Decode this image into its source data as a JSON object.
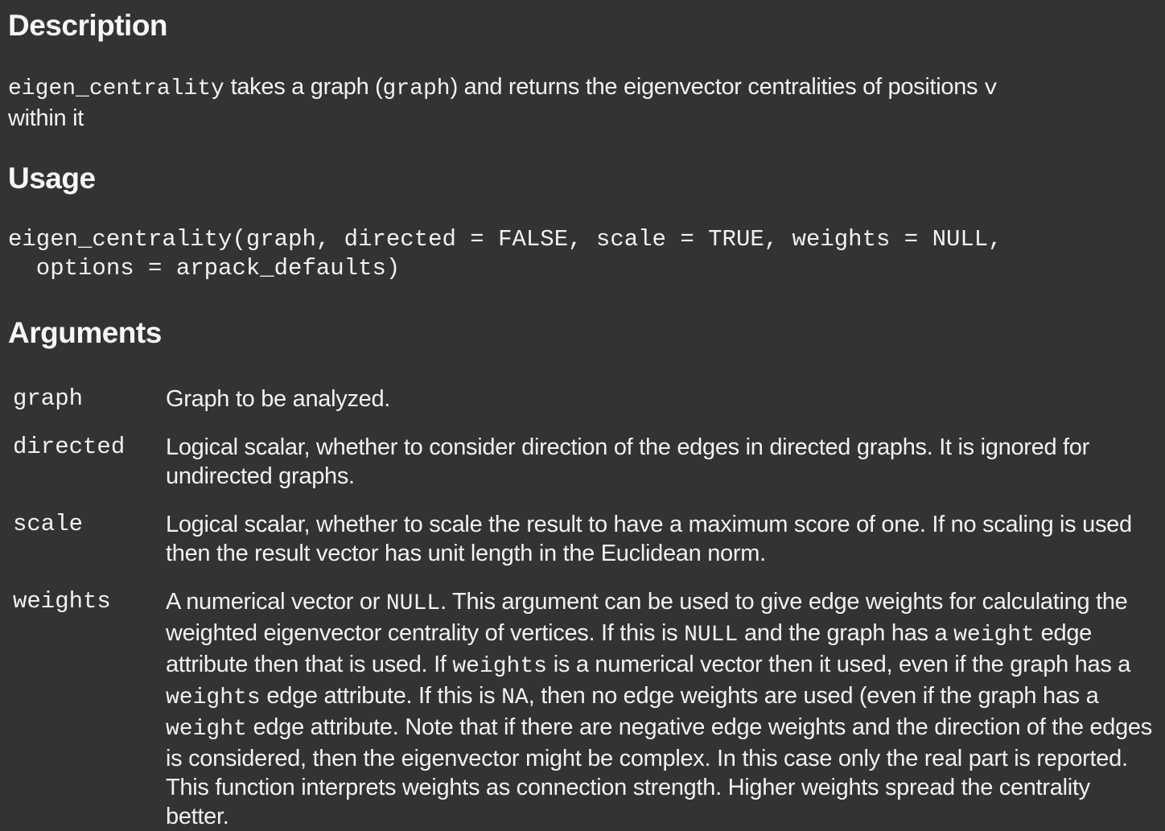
{
  "description": {
    "heading": "Description",
    "text_parts": [
      {
        "code": "eigen_centrality"
      },
      {
        "text": " takes a graph ("
      },
      {
        "code": "graph"
      },
      {
        "text": ") and returns the eigenvector centralities of positions "
      },
      {
        "code": "v"
      },
      {
        "text": " within it"
      }
    ]
  },
  "usage": {
    "heading": "Usage",
    "line1": "eigen_centrality(graph, directed = FALSE, scale = TRUE, weights = NULL,",
    "line2": "  options = arpack_defaults)"
  },
  "arguments": {
    "heading": "Arguments",
    "items": [
      {
        "name": "graph",
        "parts": [
          {
            "text": "Graph to be analyzed."
          }
        ]
      },
      {
        "name": "directed",
        "parts": [
          {
            "text": "Logical scalar, whether to consider direction of the edges in directed graphs. It is ignored for undirected graphs."
          }
        ]
      },
      {
        "name": "scale",
        "parts": [
          {
            "text": "Logical scalar, whether to scale the result to have a maximum score of one. If no scaling is used then the result vector has unit length in the Euclidean norm."
          }
        ]
      },
      {
        "name": "weights",
        "parts": [
          {
            "text": "A numerical vector or "
          },
          {
            "code": "NULL"
          },
          {
            "text": ". This argument can be used to give edge weights for calculating the weighted eigenvector centrality of vertices. If this is "
          },
          {
            "code": "NULL"
          },
          {
            "text": " and the graph has a "
          },
          {
            "code": "weight"
          },
          {
            "text": " edge attribute then that is used. If "
          },
          {
            "code": "weights"
          },
          {
            "text": " is a numerical vector then it used, even if the graph has a "
          },
          {
            "code": "weights"
          },
          {
            "text": " edge attribute. If this is "
          },
          {
            "code": "NA"
          },
          {
            "text": ", then no edge weights are used (even if the graph has a "
          },
          {
            "code": "weight"
          },
          {
            "text": " edge attribute. Note that if there are negative edge weights and the direction of the edges is considered, then the eigenvector might be complex. In this case only the real part is reported. This function interprets weights as connection strength. Higher weights spread the centrality better."
          }
        ]
      }
    ]
  }
}
